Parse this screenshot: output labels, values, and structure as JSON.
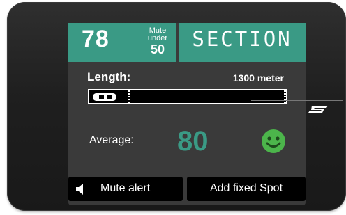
{
  "header": {
    "speed_value": "78",
    "mute_label_1": "Mute",
    "mute_label_2": "under",
    "mute_value": "50",
    "mode_label": "SECTION"
  },
  "length": {
    "label": "Length:",
    "value": "1300 meter",
    "progress": 0.0
  },
  "average": {
    "label": "Average:",
    "value": "80"
  },
  "buttons": {
    "mute_alert": "Mute alert",
    "add_fixed_spot": "Add fixed Spot"
  },
  "colors": {
    "accent": "#3a9a85",
    "smiley": "#4cb54b",
    "screen_bg": "#3a3a3a"
  },
  "icons": [
    "car-icon",
    "smiley-icon",
    "speaker-icon",
    "brand-logo"
  ]
}
